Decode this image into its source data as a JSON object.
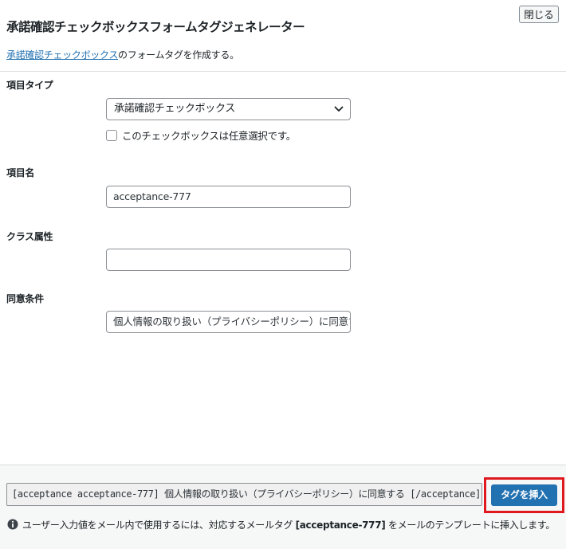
{
  "dialog": {
    "title": "承諾確認チェックボックスフォームタグジェネレーター",
    "close_label": "閉じる",
    "description_link": "承諾確認チェックボックス",
    "description_rest": "のフォームタグを作成する。"
  },
  "fields": {
    "type": {
      "label": "項目タイプ",
      "selected": "承諾確認チェックボックス",
      "optional_label": "このチェックボックスは任意選択です。",
      "optional_checked": false
    },
    "name": {
      "label": "項目名",
      "value": "acceptance-777"
    },
    "class": {
      "label": "クラス属性",
      "value": ""
    },
    "condition": {
      "label": "同意条件",
      "value": "個人情報の取り扱い（プライバシーポリシー）に同意する"
    }
  },
  "footer": {
    "tag_value": "[acceptance acceptance-777] 個人情報の取り扱い（プライバシーポリシー）に同意する [/acceptance]",
    "insert_label": "タグを挿入",
    "info_prefix": "ユーザー入力値をメール内で使用するには、対応するメールタグ ",
    "info_tag": "[acceptance-777]",
    "info_suffix": " をメールのテンプレートに挿入します。"
  },
  "colors": {
    "accent": "#2271b1",
    "highlight": "#e0191e",
    "footer_bg": "#f6f7f7"
  },
  "icons": {
    "select_arrow": "chevron-down-icon",
    "info": "info-icon"
  }
}
